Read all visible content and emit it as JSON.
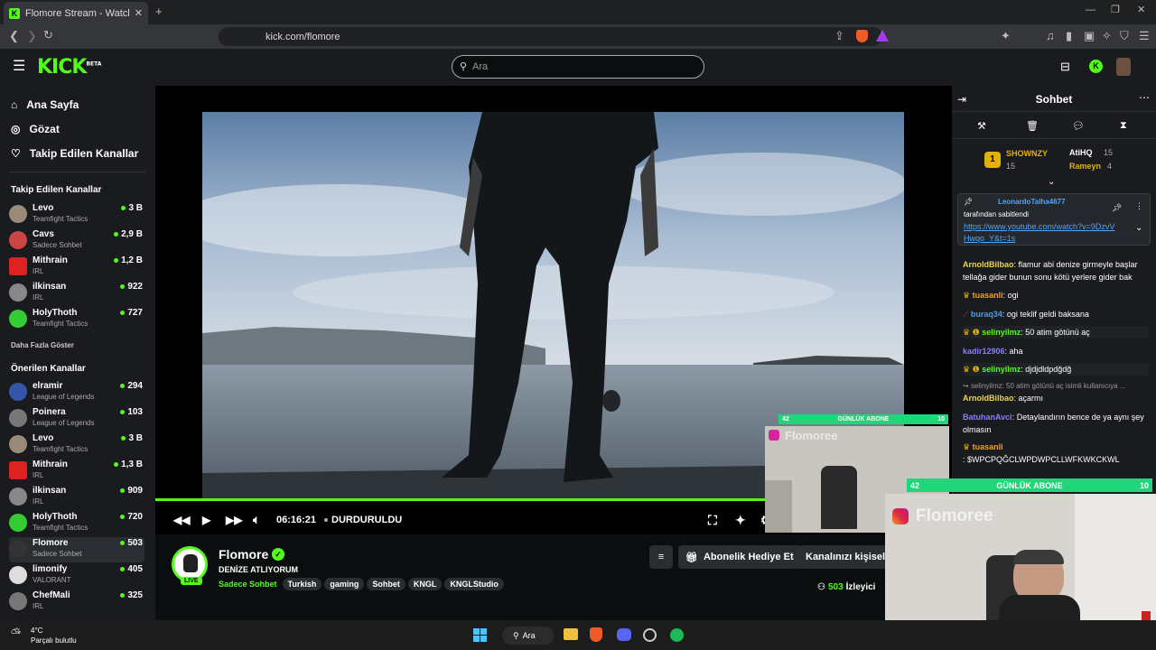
{
  "browser": {
    "tab_title": "Flomore Stream - Watch Live on",
    "url": "kick.com/flomore"
  },
  "header": {
    "logo": "KICK",
    "logo_badge": "BETA",
    "search_placeholder": "Ara"
  },
  "sidebar": {
    "nav": [
      {
        "label": "Ana Sayfa",
        "icon": "home-icon"
      },
      {
        "label": "Gözat",
        "icon": "compass-icon"
      },
      {
        "label": "Takip Edilen Kanallar",
        "icon": "heart-icon"
      }
    ],
    "followed_title": "Takip Edilen Kanallar",
    "followed": [
      {
        "name": "Levo",
        "game": "Teamfight Tactics",
        "viewers": "3 B"
      },
      {
        "name": "Cavs",
        "game": "Sadece Sohbet",
        "viewers": "2,9 B"
      },
      {
        "name": "Mithrain",
        "game": "IRL",
        "viewers": "1,2 B"
      },
      {
        "name": "ilkinsan",
        "game": "IRL",
        "viewers": "922"
      },
      {
        "name": "HolyThoth",
        "game": "Teamfight Tactics",
        "viewers": "727"
      }
    ],
    "show_more": "Daha Fazla Göster",
    "recommended_title": "Önerilen Kanallar",
    "recommended": [
      {
        "name": "elramir",
        "game": "League of Legends",
        "viewers": "294"
      },
      {
        "name": "Poinera",
        "game": "League of Legends",
        "viewers": "103"
      },
      {
        "name": "Levo",
        "game": "Teamfight Tactics",
        "viewers": "3 B"
      },
      {
        "name": "Mithrain",
        "game": "IRL",
        "viewers": "1,3 B"
      },
      {
        "name": "ilkinsan",
        "game": "IRL",
        "viewers": "909"
      },
      {
        "name": "HolyThoth",
        "game": "Teamfight Tactics",
        "viewers": "720"
      },
      {
        "name": "Flomore",
        "game": "Sadece Sohbet",
        "viewers": "503"
      },
      {
        "name": "limonify",
        "game": "VALORANT",
        "viewers": "405"
      },
      {
        "name": "ChefMali",
        "game": "IRL",
        "viewers": "325"
      }
    ]
  },
  "player": {
    "time": "06:16:21",
    "status": "DURDURULDU"
  },
  "stream": {
    "channel": "Flomore",
    "title": "DENİZE ATLIYORUM",
    "category": "Sadece Sohbet",
    "tags": [
      "Turkish",
      "gaming",
      "Sohbet",
      "KNGL",
      "KNGLStudio"
    ],
    "live": "LIVE",
    "viewers": "503",
    "viewers_label": "İzleyici",
    "gift_button": "Abonelik Hediye Et",
    "customize_button": "Kanalınızı kişisell"
  },
  "chat": {
    "title": "Sohbet",
    "top_gifters": [
      {
        "rank": "1",
        "name": "SHOWNZY",
        "count": "15"
      },
      {
        "name": "AtiHQ",
        "count": "15"
      },
      {
        "name": "Rameyn",
        "count": "4"
      }
    ],
    "pinned_by": "LeonardoTalha4677",
    "pinned_suffix": "tarafından sabitlendi",
    "pinned_link": "https://www.youtube.com/watch?v=9DzvVHwqo_Y&t=1s",
    "messages": [
      {
        "user": "ArnoldBilbao",
        "text": ": flamur abi denize girmeyle başlar tellağa gider bunun sonu kötü yerlere gider bak",
        "color": "#e8d44d"
      },
      {
        "user": "tuasanli",
        "text": ": ogi",
        "color": "#f0a020"
      },
      {
        "user": "buraq34",
        "text": ": ogi teklif geldi baksana",
        "color": "#4d9de0"
      },
      {
        "user": "selinyilmz",
        "text": ": 50 atim götünü aç",
        "color": "#53fc18"
      },
      {
        "user": "kadir12906",
        "text": ": aha",
        "color": "#8a7cff"
      },
      {
        "user": "selinyilmz",
        "text": ": djdjdldpdğdğ",
        "color": "#53fc18"
      },
      {
        "user": "",
        "text": "selinyilmz: 50 atim götünü aç isimli kullanıcıya ...",
        "color": "#aaa"
      },
      {
        "user": "ArnoldBilbao",
        "text": ": açarmı",
        "color": "#e8d44d"
      },
      {
        "user": "BatuhanAvci",
        "text": ": Detaylandırın bence de ya aynı şey olmasın",
        "color": "#8a7cff"
      },
      {
        "user": "tuasanli",
        "text": ": $WPCPQĞCLWPDWPCLLWFKWKCKWL",
        "color": "#f0a020"
      }
    ]
  },
  "overlay": {
    "bar_label": "GÜNLÜK ABONE",
    "bar_left": "42",
    "bar_right": "10",
    "cam_name": "Flomoree"
  },
  "taskbar": {
    "temp": "4°C",
    "weather": "Parçalı bulutlu",
    "search": "Ara"
  }
}
